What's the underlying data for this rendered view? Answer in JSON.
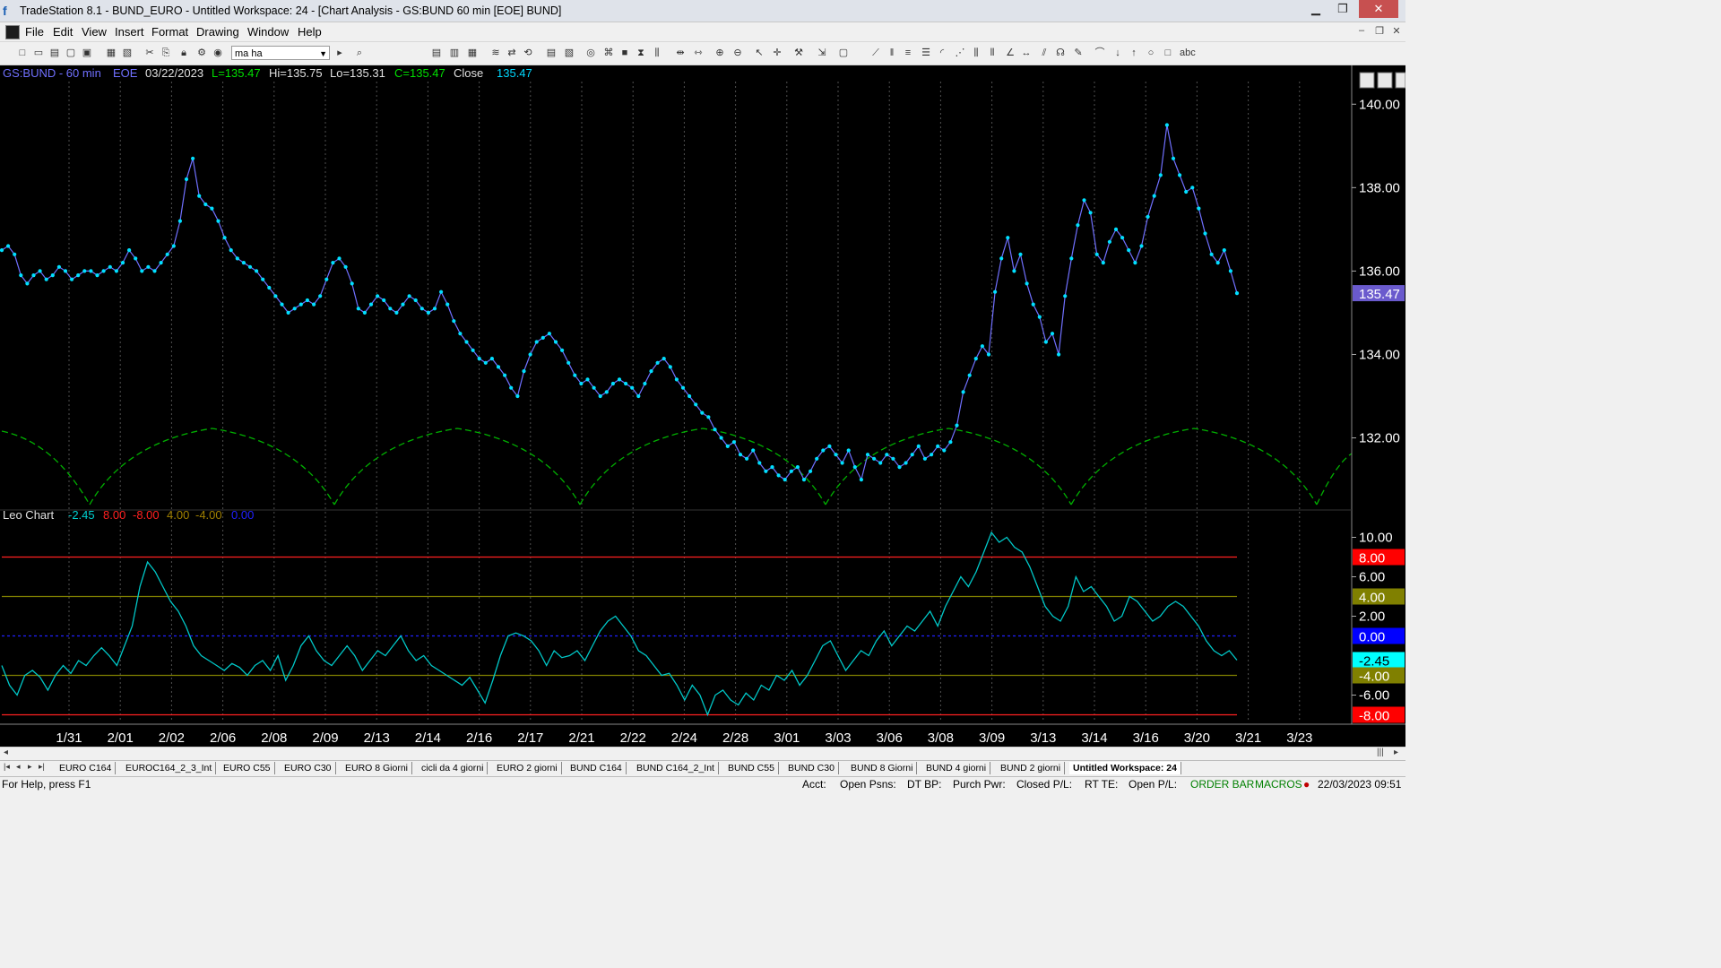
{
  "window": {
    "title": "TradeStation 8.1 - BUND_EURO - Untitled Workspace:  24 - [Chart Analysis - GS:BUND  60 min  [EOE] BUND]",
    "min_icon": "minimize-icon",
    "max_icon": "maximize-icon",
    "close_icon": "close-icon"
  },
  "menu": {
    "items": [
      "File",
      "Edit",
      "View",
      "Insert",
      "Format",
      "Drawing",
      "Window",
      "Help"
    ]
  },
  "toolbar": {
    "combo_value": "ma ha"
  },
  "chart_header": {
    "symbol": "GS:BUND - 60 min",
    "exchange": "EOE",
    "date": "03/22/2023",
    "low": "L=135.47",
    "high": "Hi=135.75",
    "lo": "Lo=135.31",
    "close": "C=135.47",
    "close_label": "Close",
    "close_value": "135.47"
  },
  "indicator_header": {
    "name": "Leo Chart",
    "values": [
      "-2.45",
      "8.00",
      "-8.00",
      "4.00",
      "-4.00",
      "0.00"
    ],
    "colors": [
      "#00d0d0",
      "#ff2020",
      "#ff2020",
      "#a08000",
      "#a08000",
      "#2020ff"
    ]
  },
  "colors": {
    "price_line": "#7070ff",
    "price_dots": "#00e0ff",
    "cycle": "#00b000",
    "osc": "#00c8c8",
    "upper8": "#ff2020",
    "level4": "#808000",
    "zero": "#2020ff"
  },
  "chart_data": [
    {
      "type": "line",
      "title": "GS:BUND - 60 min",
      "x_tick_labels": [
        "1/31",
        "2/01",
        "2/02",
        "2/06",
        "2/08",
        "2/09",
        "2/13",
        "2/14",
        "2/16",
        "2/17",
        "2/21",
        "2/22",
        "2/24",
        "2/28",
        "3/01",
        "3/03",
        "3/06",
        "3/08",
        "3/09",
        "3/13",
        "3/14",
        "3/16",
        "3/20",
        "3/21",
        "3/23"
      ],
      "y_ticks": [
        "140.00",
        "138.00",
        "136.00",
        "134.00",
        "132.00"
      ],
      "ylim": [
        130.4,
        140.5
      ],
      "last_price_label": "135.47",
      "series": [
        {
          "values": [
            136.5,
            136.6,
            136.4,
            135.9,
            135.7,
            135.9,
            136.0,
            135.8,
            135.9,
            136.1,
            136.0,
            135.8,
            135.9,
            136.0,
            136.0,
            135.9,
            136.0,
            136.1,
            136.0,
            136.2,
            136.5,
            136.3,
            136.0,
            136.1,
            136.0,
            136.2,
            136.4,
            136.6,
            137.2,
            138.2,
            138.7,
            137.8,
            137.6,
            137.5,
            137.2,
            136.8,
            136.5,
            136.3,
            136.2,
            136.1,
            136.0,
            135.8,
            135.6,
            135.4,
            135.2,
            135.0,
            135.1,
            135.2,
            135.3,
            135.2,
            135.4,
            135.8,
            136.2,
            136.3,
            136.1,
            135.7,
            135.1,
            135.0,
            135.2,
            135.4,
            135.3,
            135.1,
            135.0,
            135.2,
            135.4,
            135.3,
            135.1,
            135.0,
            135.1,
            135.5,
            135.2,
            134.8,
            134.5,
            134.3,
            134.1,
            133.9,
            133.8,
            133.9,
            133.7,
            133.5,
            133.2,
            133.0,
            133.6,
            134.0,
            134.3,
            134.4,
            134.5,
            134.3,
            134.1,
            133.8,
            133.5,
            133.3,
            133.4,
            133.2,
            133.0,
            133.1,
            133.3,
            133.4,
            133.3,
            133.2,
            133.0,
            133.3,
            133.6,
            133.8,
            133.9,
            133.7,
            133.4,
            133.2,
            133.0,
            132.8,
            132.6,
            132.5,
            132.2,
            132.0,
            131.8,
            131.9,
            131.6,
            131.5,
            131.7,
            131.4,
            131.2,
            131.3,
            131.1,
            131.0,
            131.2,
            131.3,
            131.0,
            131.2,
            131.5,
            131.7,
            131.8,
            131.6,
            131.4,
            131.7,
            131.3,
            131.0,
            131.6,
            131.5,
            131.4,
            131.6,
            131.5,
            131.3,
            131.4,
            131.6,
            131.8,
            131.5,
            131.6,
            131.8,
            131.7,
            131.9,
            132.3,
            133.1,
            133.5,
            133.9,
            134.2,
            134.0,
            135.5,
            136.3,
            136.8,
            136.0,
            136.4,
            135.7,
            135.2,
            134.9,
            134.3,
            134.5,
            134.0,
            135.4,
            136.3,
            137.1,
            137.7,
            137.4,
            136.4,
            136.2,
            136.7,
            137.0,
            136.8,
            136.5,
            136.2,
            136.6,
            137.3,
            137.8,
            138.3,
            139.5,
            138.7,
            138.3,
            137.9,
            138.0,
            137.5,
            136.9,
            136.4,
            136.2,
            136.5,
            136.0,
            135.47
          ]
        }
      ]
    },
    {
      "type": "line",
      "title": "Leo Chart",
      "y_ticks": [
        "10.00",
        "6.00",
        "2.00",
        "-6.00"
      ],
      "ylim": [
        -8.5,
        11.5
      ],
      "reference_levels": [
        8.0,
        4.0,
        0.0,
        -4.0,
        -8.0
      ],
      "level_labels": [
        "8.00",
        "6.00",
        "4.00",
        "2.00",
        "0.00",
        "-2.45",
        "-4.00",
        "-6.00",
        "-8.00"
      ],
      "series": [
        {
          "values": [
            -3.0,
            -5.0,
            -6.0,
            -4.0,
            -3.5,
            -4.2,
            -5.5,
            -4.0,
            -3.0,
            -3.8,
            -2.5,
            -3.0,
            -2.0,
            -1.2,
            -2.0,
            -3.0,
            -1.0,
            1.0,
            5.0,
            7.5,
            6.5,
            5.0,
            3.5,
            2.5,
            1.0,
            -1.0,
            -2.0,
            -2.5,
            -3.0,
            -3.5,
            -2.8,
            -3.2,
            -4.0,
            -3.0,
            -2.5,
            -3.5,
            -2.0,
            -4.5,
            -3.0,
            -1.0,
            0.0,
            -1.5,
            -2.5,
            -3.0,
            -2.0,
            -1.0,
            -2.0,
            -3.5,
            -2.5,
            -1.5,
            -2.0,
            -1.0,
            0.0,
            -1.5,
            -2.5,
            -2.0,
            -3.0,
            -3.5,
            -4.0,
            -4.5,
            -5.0,
            -4.2,
            -5.5,
            -6.8,
            -4.5,
            -2.0,
            0.0,
            0.3,
            0.0,
            -0.5,
            -1.5,
            -3.0,
            -1.5,
            -2.2,
            -2.0,
            -1.5,
            -2.5,
            -1.0,
            0.5,
            1.5,
            2.0,
            1.0,
            0.0,
            -1.5,
            -2.0,
            -3.0,
            -4.0,
            -3.8,
            -5.0,
            -6.5,
            -5.0,
            -6.0,
            -8.0,
            -6.0,
            -5.5,
            -6.5,
            -7.0,
            -5.8,
            -6.5,
            -5.0,
            -5.5,
            -4.0,
            -4.5,
            -3.5,
            -5.0,
            -4.0,
            -2.5,
            -1.0,
            -0.5,
            -2.0,
            -3.5,
            -2.5,
            -1.5,
            -2.0,
            -0.5,
            0.5,
            -1.0,
            0.0,
            1.0,
            0.5,
            1.5,
            2.5,
            1.0,
            3.0,
            4.5,
            6.0,
            5.0,
            6.5,
            8.5,
            10.5,
            9.5,
            10.0,
            9.0,
            8.5,
            7.0,
            5.0,
            3.0,
            2.0,
            1.5,
            3.0,
            6.0,
            4.5,
            5.0,
            4.0,
            3.0,
            1.5,
            2.0,
            4.0,
            3.5,
            2.5,
            1.5,
            2.0,
            3.0,
            3.5,
            3.0,
            2.0,
            1.0,
            -0.5,
            -1.5,
            -2.0,
            -1.5,
            -2.45
          ]
        }
      ],
      "cycle_lows_x_labels": [
        "1/31",
        "2/08",
        "2/16",
        "2/24",
        "3/03",
        "3/13",
        "3/21"
      ]
    }
  ],
  "tabs": {
    "items": [
      "EURO C164",
      "EUROC164_2_3_Int",
      "EURO C55",
      "EURO C30",
      "EURO 8 Giorni",
      "cicli da 4 giorni",
      "EURO 2 giorni",
      "BUND C164",
      "BUND C164_2_Int",
      "BUND C55",
      "BUND  C30",
      "BUND 8 Giorni",
      "BUND 4 giorni",
      "BUND 2 giorni",
      "Untitled Workspace:  24"
    ],
    "active": "Untitled Workspace:  24"
  },
  "status": {
    "help": "For Help, press F1",
    "acct": "Acct:",
    "open_psns": "Open Psns:",
    "dt_bp": "DT BP:",
    "purch_pwr": "Purch Pwr:",
    "closed_pl": "Closed P/L:",
    "rt_te": "RT TE:",
    "open_pl": "Open P/L:",
    "order_bar": "ORDER BAR",
    "macros": "MACROS",
    "datetime": "22/03/2023 09:51"
  }
}
